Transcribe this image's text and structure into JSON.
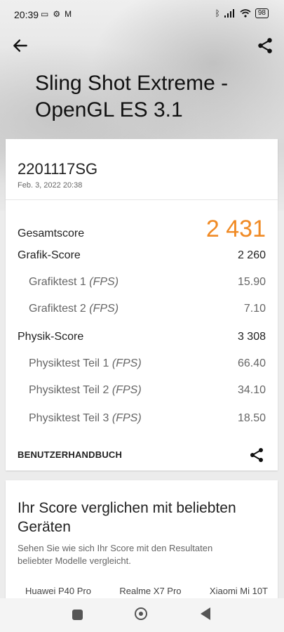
{
  "status": {
    "time": "20:39",
    "battery": "98"
  },
  "header": {
    "title": "Sling Shot Extreme - OpenGL ES 3.1"
  },
  "result": {
    "device": "2201117SG",
    "date": "Feb. 3, 2022 20:38",
    "total_label": "Gesamtscore",
    "total_value": "2 431",
    "graphics_label": "Grafik-Score",
    "graphics_value": "2 260",
    "gt1_label": "Grafiktest 1",
    "gt1_value": "15.90",
    "gt2_label": "Grafiktest 2",
    "gt2_value": "7.10",
    "physics_label": "Physik-Score",
    "physics_value": "3 308",
    "pt1_label": "Physiktest Teil 1",
    "pt1_value": "66.40",
    "pt2_label": "Physiktest Teil 2",
    "pt2_value": "34.10",
    "pt3_label": "Physiktest Teil 3",
    "pt3_value": "18.50",
    "fps_unit": "(FPS)",
    "manual_label": "BENUTZERHANDBUCH"
  },
  "compare": {
    "title": "Ihr Score verglichen mit beliebten Geräten",
    "description": "Sehen Sie wie sich Ihr Score mit den Resultaten beliebter Modelle vergleicht.",
    "devices": [
      "Huawei P40 Pro",
      "Realme X7 Pro",
      "Xiaomi Mi 10T"
    ]
  },
  "colors": {
    "accent": "#f08a24"
  },
  "icons": {
    "back": "arrow-left-icon",
    "share": "share-icon"
  }
}
